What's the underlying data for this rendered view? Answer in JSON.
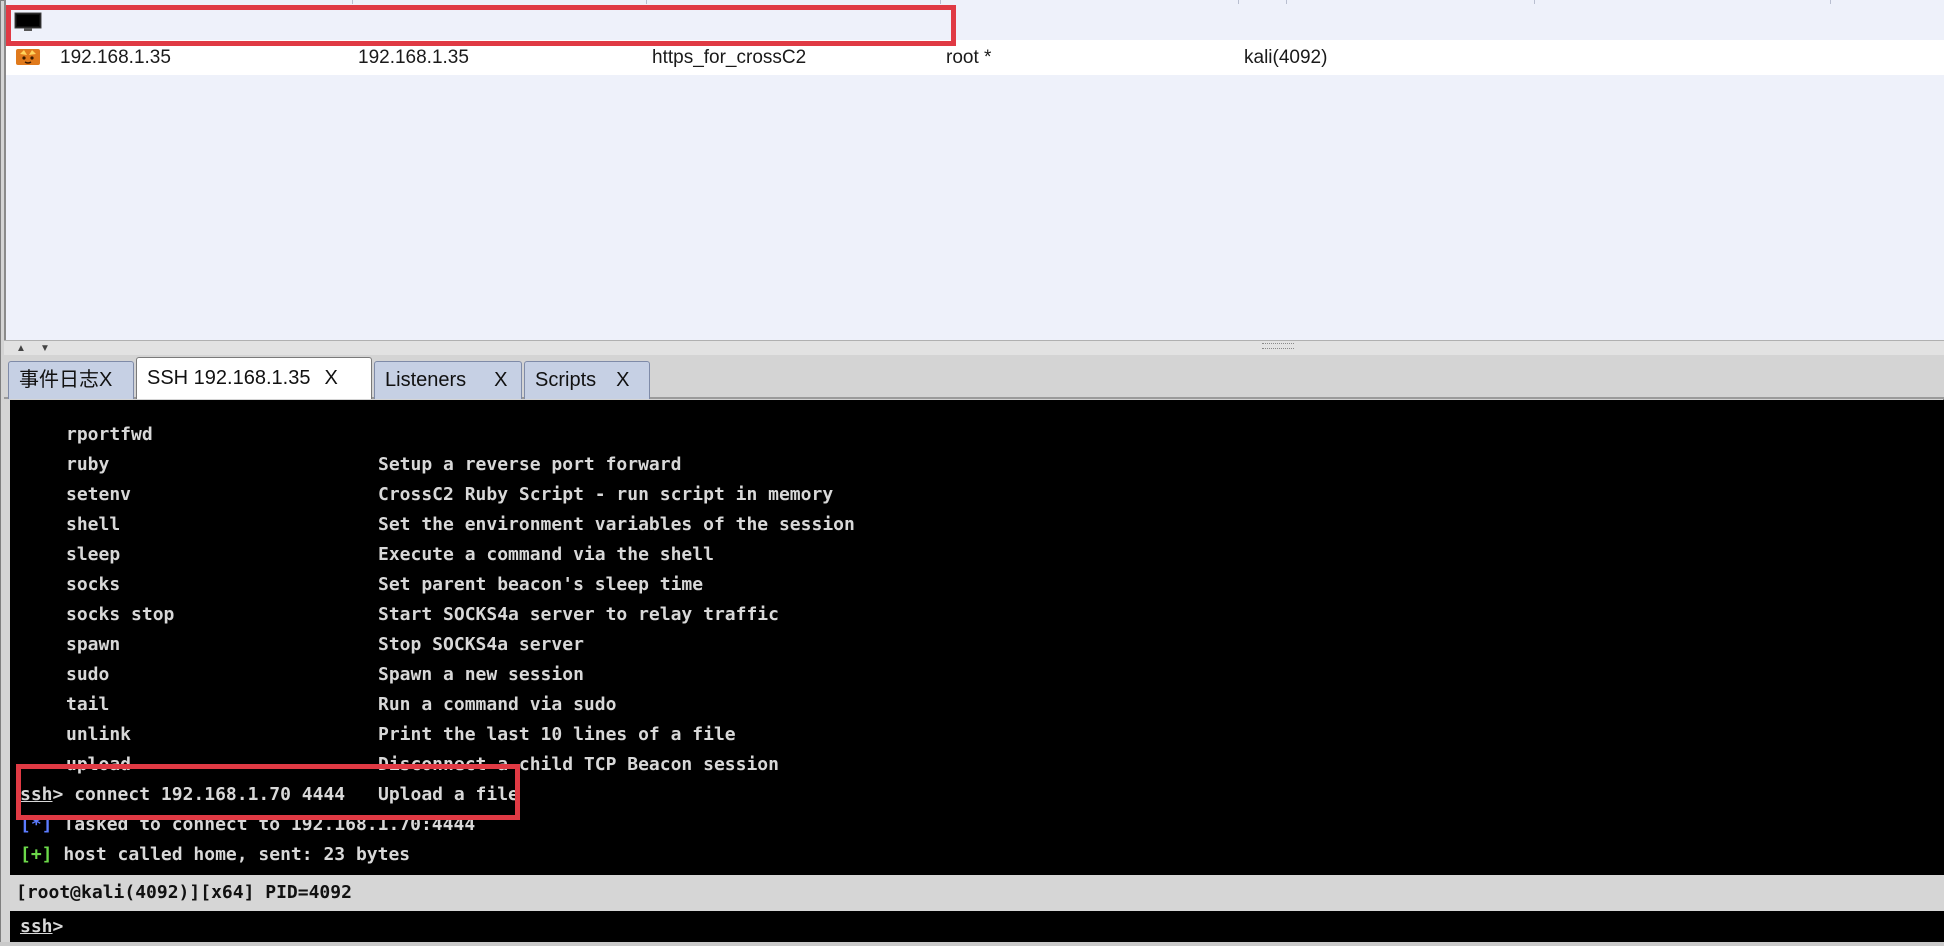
{
  "sessions": {
    "rows": [
      {
        "icon": "monitor-icon",
        "external": "",
        "internal": "",
        "listener": "",
        "user": "",
        "process": ""
      },
      {
        "icon": "fox-session-icon",
        "external": "192.168.1.35",
        "internal": "192.168.1.35",
        "listener": "https_for_crossC2",
        "user": "root *",
        "process": "kali(4092)"
      }
    ]
  },
  "tabs": [
    {
      "label": "事件日志",
      "close": "X"
    },
    {
      "label": "SSH 192.168.1.35",
      "close": "X"
    },
    {
      "label": "Listeners",
      "close": "X"
    },
    {
      "label": "Scripts",
      "close": "X"
    }
  ],
  "console": {
    "help_rows": [
      {
        "cmd": "rportfwd",
        "desc": "Setup a reverse port forward"
      },
      {
        "cmd": "ruby",
        "desc": "CrossC2 Ruby Script - run script in memory"
      },
      {
        "cmd": "setenv",
        "desc": "Set the environment variables of the session"
      },
      {
        "cmd": "shell",
        "desc": "Execute a command via the shell"
      },
      {
        "cmd": "sleep",
        "desc": "Set parent beacon's sleep time"
      },
      {
        "cmd": "socks",
        "desc": "Start SOCKS4a server to relay traffic"
      },
      {
        "cmd": "socks stop",
        "desc": "Stop SOCKS4a server"
      },
      {
        "cmd": "spawn",
        "desc": "Spawn a new session"
      },
      {
        "cmd": "sudo",
        "desc": "Run a command via sudo"
      },
      {
        "cmd": "tail",
        "desc": "Print the last 10 lines of a file"
      },
      {
        "cmd": "unlink",
        "desc": "Disconnect a child TCP Beacon session"
      },
      {
        "cmd": "upload",
        "desc": "Upload a file"
      }
    ],
    "prompt": "ssh",
    "prompt_sep": ">",
    "command": " connect 192.168.1.70 4444",
    "output": [
      {
        "tag": "[*]",
        "text": " Tasked to connect to 192.168.1.70:4444"
      },
      {
        "tag": "[+]",
        "text": " host called home, sent: 23 bytes"
      }
    ]
  },
  "status": {
    "text": "[root@kali(4092)][x64] PID=4092"
  },
  "input": {
    "prompt": "ssh",
    "sep": ">",
    "value": ""
  },
  "colors": {
    "highlight": "#e03a44",
    "info_tag": "#5c7cff",
    "success_tag": "#6cd94a"
  }
}
